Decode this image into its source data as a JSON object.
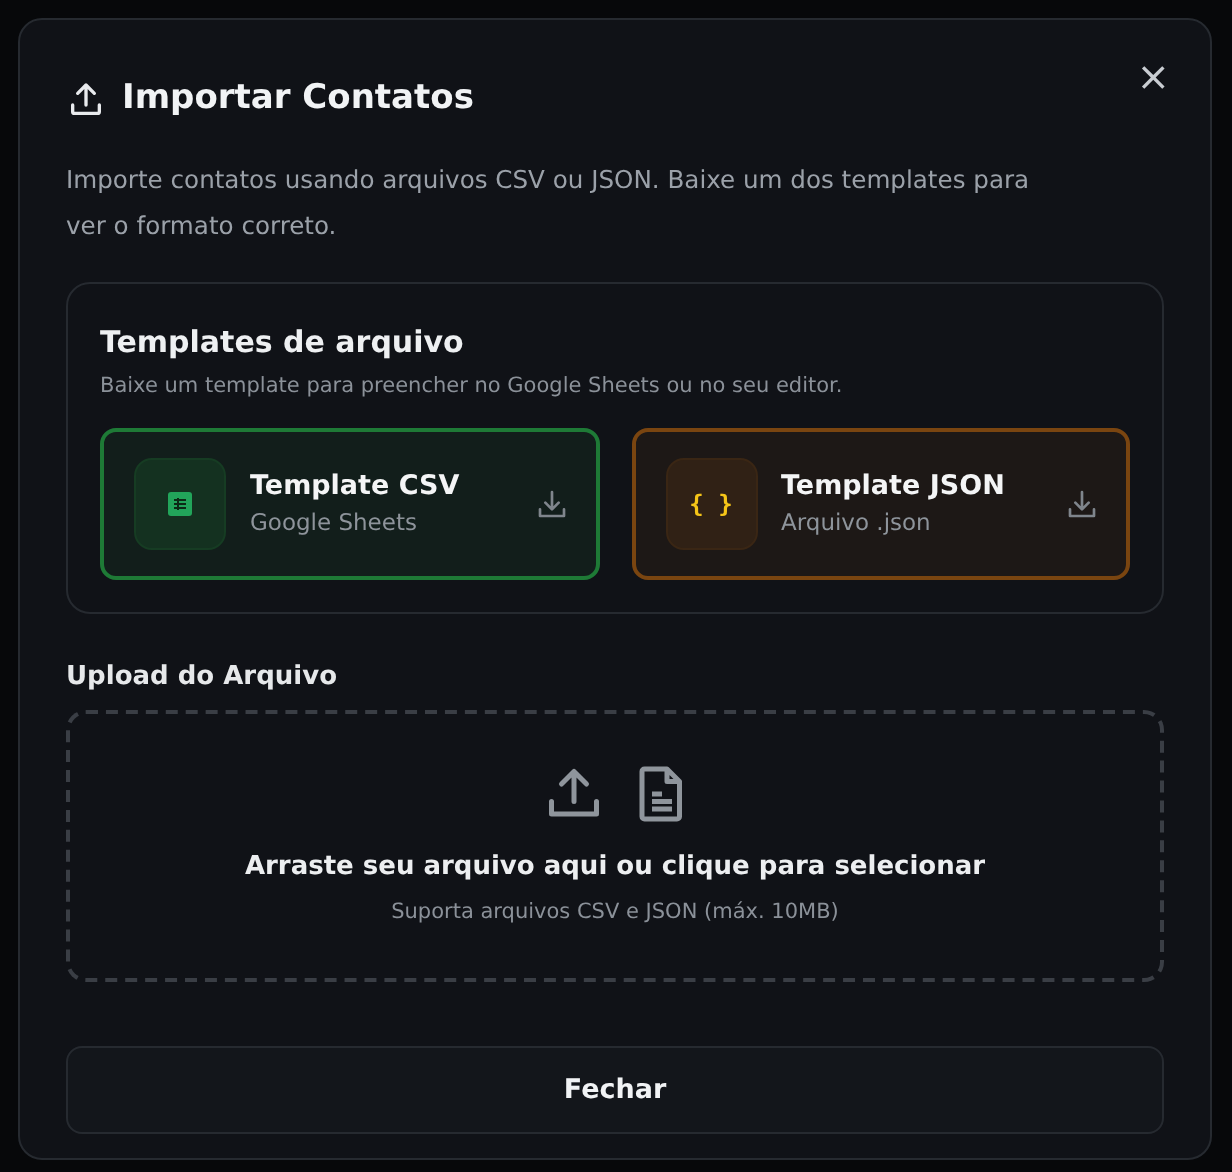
{
  "dialog": {
    "title": "Importar Contatos",
    "description": "Importe contatos usando arquivos CSV ou JSON. Baixe um dos templates para ver o formato correto.",
    "close": "×"
  },
  "templates": {
    "title": "Templates de arquivo",
    "subtitle": "Baixe um template para preencher no Google Sheets ou no seu editor.",
    "items": [
      {
        "kind": "sheet",
        "title": "Template CSV",
        "subtitle": "Google Sheets",
        "color": "#1e7a36"
      },
      {
        "kind": "code",
        "title": "Template JSON",
        "subtitle": "Arquivo .json",
        "color": "#7a4510",
        "icon_text": "{ }"
      }
    ]
  },
  "upload": {
    "label": "Upload do Arquivo",
    "prompt": "Arraste seu arquivo aqui ou clique para selecionar",
    "hint": "Suporta arquivos CSV e JSON (máx. 10MB)"
  },
  "buttons": [
    {
      "label": "Fechar"
    }
  ]
}
